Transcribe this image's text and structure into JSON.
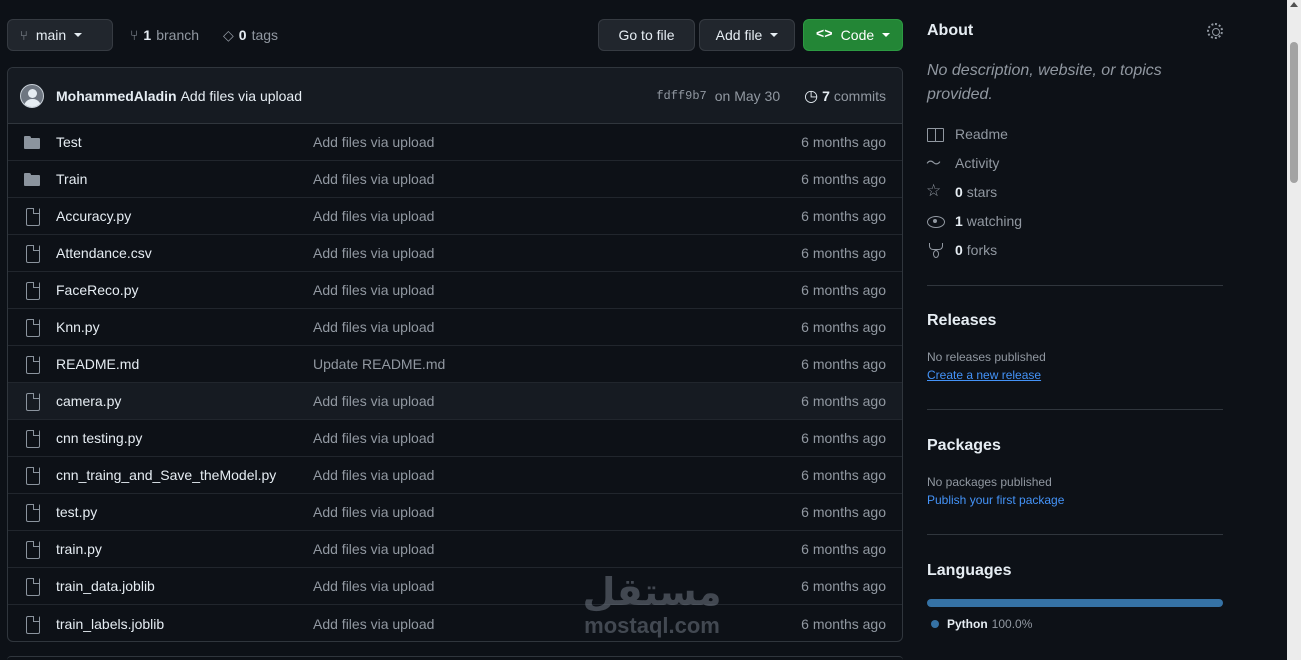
{
  "toolbar": {
    "branch_name": "main",
    "branch_count": "1",
    "branch_label": "branch",
    "tag_count": "0",
    "tag_label": "tags",
    "goto_label": "Go to file",
    "addfile_label": "Add file",
    "code_label": "Code"
  },
  "commit": {
    "author": "MohammedAladin",
    "message": "Add files via upload",
    "sha": "fdff9b7",
    "date": "on May 30",
    "commit_count": "7",
    "commit_label": "commits"
  },
  "files": [
    {
      "name": "Test",
      "type": "folder",
      "message": "Add files via upload",
      "date": "6 months ago"
    },
    {
      "name": "Train",
      "type": "folder",
      "message": "Add files via upload",
      "date": "6 months ago"
    },
    {
      "name": "Accuracy.py",
      "type": "file",
      "message": "Add files via upload",
      "date": "6 months ago"
    },
    {
      "name": "Attendance.csv",
      "type": "file",
      "message": "Add files via upload",
      "date": "6 months ago"
    },
    {
      "name": "FaceReco.py",
      "type": "file",
      "message": "Add files via upload",
      "date": "6 months ago"
    },
    {
      "name": "Knn.py",
      "type": "file",
      "message": "Add files via upload",
      "date": "6 months ago"
    },
    {
      "name": "README.md",
      "type": "file",
      "message": "Update README.md",
      "date": "6 months ago"
    },
    {
      "name": "camera.py",
      "type": "file",
      "message": "Add files via upload",
      "date": "6 months ago"
    },
    {
      "name": "cnn testing.py",
      "type": "file",
      "message": "Add files via upload",
      "date": "6 months ago"
    },
    {
      "name": "cnn_traing_and_Save_theModel.py",
      "type": "file",
      "message": "Add files via upload",
      "date": "6 months ago"
    },
    {
      "name": "test.py",
      "type": "file",
      "message": "Add files via upload",
      "date": "6 months ago"
    },
    {
      "name": "train.py",
      "type": "file",
      "message": "Add files via upload",
      "date": "6 months ago"
    },
    {
      "name": "train_data.joblib",
      "type": "file",
      "message": "Add files via upload",
      "date": "6 months ago"
    },
    {
      "name": "train_labels.joblib",
      "type": "file",
      "message": "Add files via upload",
      "date": "6 months ago"
    }
  ],
  "about": {
    "title": "About",
    "description": "No description, website, or topics provided.",
    "readme": "Readme",
    "activity": "Activity",
    "stars_count": "0",
    "stars_label": "stars",
    "watching_count": "1",
    "watching_label": "watching",
    "forks_count": "0",
    "forks_label": "forks"
  },
  "releases": {
    "title": "Releases",
    "empty": "No releases published",
    "link": "Create a new release"
  },
  "packages": {
    "title": "Packages",
    "empty": "No packages published",
    "link": "Publish your first package"
  },
  "languages": {
    "title": "Languages",
    "items": [
      {
        "name": "Python",
        "percent": "100.0%",
        "color": "#3572A5"
      }
    ]
  },
  "watermark": {
    "arabic": "مستقل",
    "latin": "mostaql.com"
  },
  "colors": {
    "background": "#0d1117",
    "code_button": "#238636",
    "link": "#4493f8"
  }
}
